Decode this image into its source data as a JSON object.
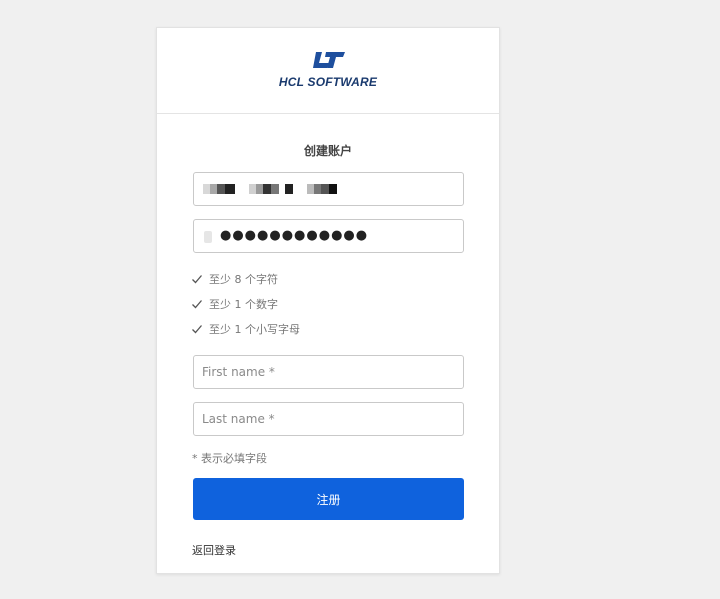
{
  "brand": {
    "logo_icon": "hcl-logo-icon",
    "name": "HCL SOFTWARE",
    "color": "#1a3a6e"
  },
  "form": {
    "title": "创建账户",
    "password_dots": "●●●●●●●●●●●●",
    "password_rules": [
      {
        "label": "至少 8 个字符",
        "icon": "check-icon"
      },
      {
        "label": "至少 1 个数字",
        "icon": "check-icon"
      },
      {
        "label": "至少 1 个小写字母",
        "icon": "check-icon"
      }
    ],
    "first_name_placeholder": "First name *",
    "last_name_placeholder": "Last name *",
    "required_hint": "* 表示必填字段",
    "submit_label": "注册",
    "submit_color": "#0f62dd",
    "back_link": "返回登录"
  }
}
